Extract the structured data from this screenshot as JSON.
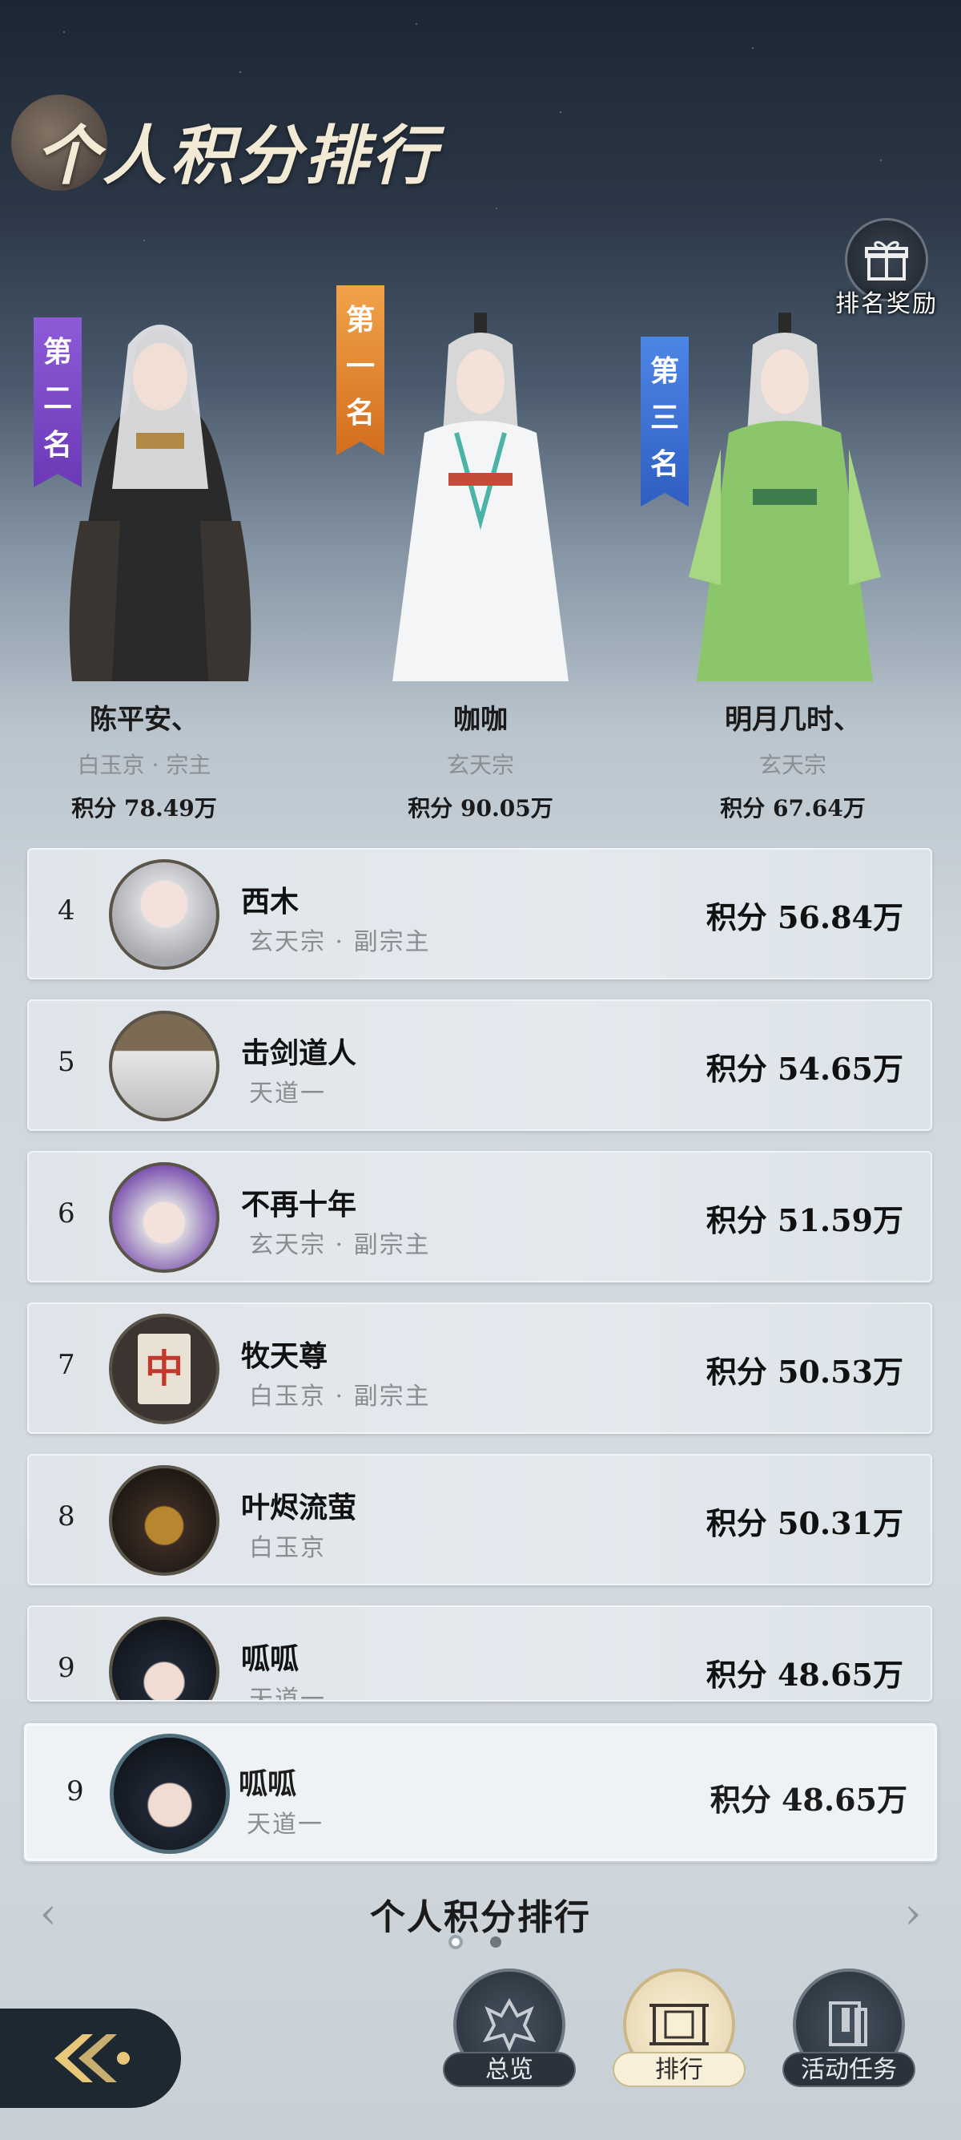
{
  "header": {
    "title": "个人积分排行"
  },
  "reward": {
    "label": "排名奖励"
  },
  "podium": [
    {
      "banner": [
        "第",
        "二",
        "名"
      ],
      "name": "陈平安、",
      "sect": "白玉京 · 宗主",
      "score": "积分 78.49万"
    },
    {
      "banner": [
        "第",
        "一",
        "名"
      ],
      "name": "咖咖",
      "sect": "玄天宗",
      "score": "积分 90.05万"
    },
    {
      "banner": [
        "第",
        "三",
        "名"
      ],
      "name": "明月几时、",
      "sect": "玄天宗",
      "score": "积分 67.64万"
    }
  ],
  "rankings": [
    {
      "rank": "4",
      "name": "西木",
      "sect": "玄天宗 · 副宗主",
      "score": "积分 56.84万"
    },
    {
      "rank": "5",
      "name": "击剑道人",
      "sect": "天道一",
      "score": "积分 54.65万"
    },
    {
      "rank": "6",
      "name": "不再十年",
      "sect": "玄天宗 · 副宗主",
      "score": "积分 51.59万"
    },
    {
      "rank": "7",
      "name": "牧天尊",
      "sect": "白玉京 · 副宗主",
      "score": "积分 50.53万"
    },
    {
      "rank": "8",
      "name": "叶烬流萤",
      "sect": "白玉京",
      "score": "积分 50.31万"
    },
    {
      "rank": "9",
      "name": "呱呱",
      "sect": "天道一",
      "score": "积分 48.65万"
    }
  ],
  "my_rank": {
    "rank": "9",
    "name": "呱呱",
    "sect": "天道一",
    "score": "积分 48.65万"
  },
  "pager": {
    "title": "个人积分排行",
    "page": 1,
    "pages": 2
  },
  "nav": [
    {
      "label": "总览",
      "icon": "overview-icon",
      "active": false
    },
    {
      "label": "排行",
      "icon": "ranking-icon",
      "active": true
    },
    {
      "label": "活动任务",
      "icon": "task-icon",
      "active": false
    }
  ],
  "colors": {
    "first": "#e38a33",
    "second": "#7c4ac7",
    "third": "#3d72d4"
  }
}
